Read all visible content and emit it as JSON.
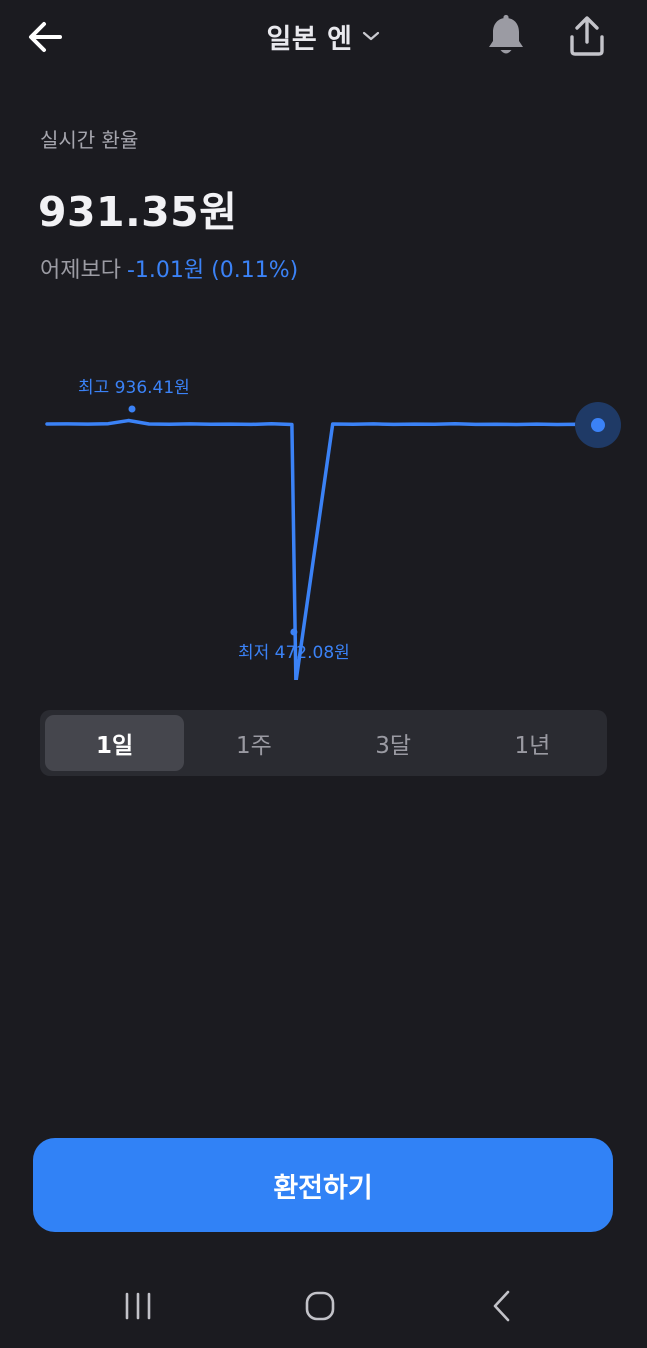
{
  "header": {
    "back_icon": "arrow-left-icon",
    "title": "일본 엔",
    "dropdown_icon": "chevron-down-icon",
    "bell_icon": "bell-icon",
    "share_icon": "share-icon"
  },
  "rate": {
    "label": "실시간 환율",
    "value": "931.35원",
    "change_label": "어제보다",
    "change_value": "-1.01원 (0.11%)"
  },
  "chart_data": {
    "type": "line",
    "high_label": "최고 936.41원",
    "low_label": "최저 472.08원",
    "high": 936.41,
    "low": 472.08,
    "current": 931.35,
    "values": [
      932.5,
      932.6,
      932.4,
      932.8,
      936.41,
      932.5,
      932.3,
      932.6,
      932.2,
      932.4,
      932.1,
      932.7,
      932.0,
      472.08,
      932.5,
      932.2,
      932.6,
      932.1,
      932.4,
      932.2,
      932.7,
      932.1,
      932.3,
      932.0,
      932.4,
      931.9,
      932.2,
      931.35
    ],
    "line_color": "#3b82f6"
  },
  "tabs": {
    "items": [
      "1일",
      "1주",
      "3달",
      "1년"
    ],
    "active_index": 0
  },
  "actions": {
    "exchange_label": "환전하기"
  },
  "navbar": {
    "recent_icon": "recent-apps-icon",
    "home_icon": "home-icon",
    "back_icon": "nav-back-icon"
  },
  "colors": {
    "background": "#1b1b20",
    "accent": "#3182f6",
    "change": "#3b82f6"
  }
}
